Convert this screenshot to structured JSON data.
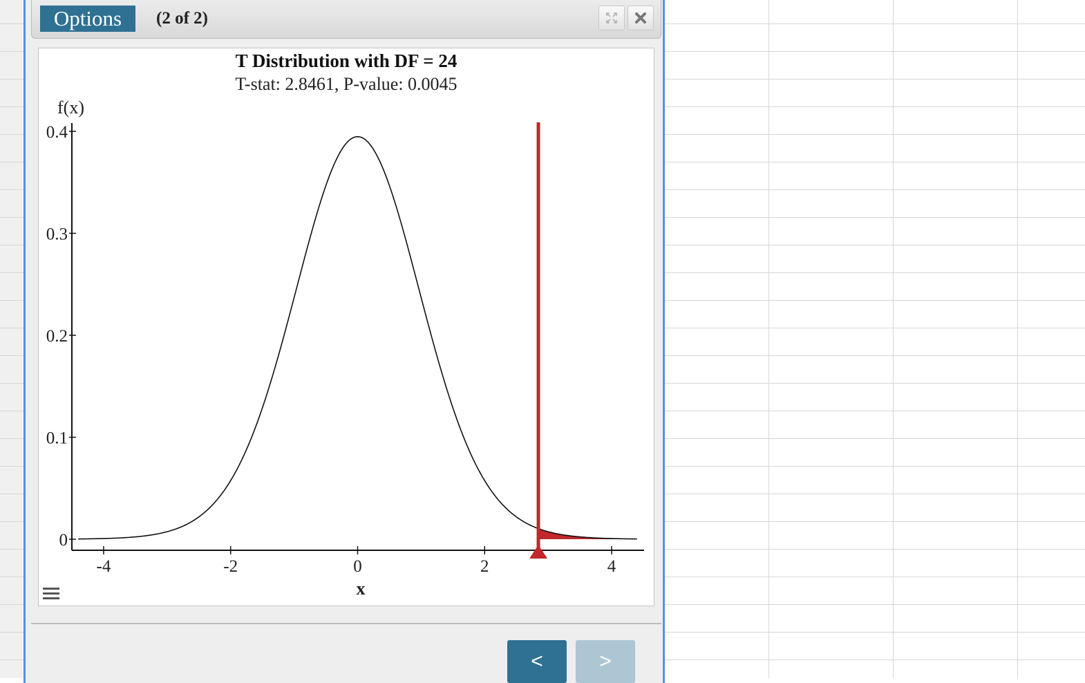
{
  "dialog": {
    "options_label": "Options",
    "page_count": "(2 of 2)",
    "prev_label": "<",
    "next_label": ">"
  },
  "colors": {
    "accent": "#2f7193",
    "accent_disabled": "#adc6d3",
    "border_accent": "#5b8ee6",
    "critical": "#c0282b"
  },
  "icons": [
    "expand-icon",
    "close-icon",
    "menu-icon"
  ],
  "chart_data": {
    "type": "line",
    "title": "T Distribution with DF = 24",
    "subtitle": "T-stat: 2.8461, P-value: 0.0045",
    "xlabel": "x",
    "ylabel": "f(x)",
    "df": 24,
    "t_stat": 2.8461,
    "p_value": 0.0045,
    "xlim": [
      -4.5,
      4.5
    ],
    "ylim": [
      0,
      0.4
    ],
    "curve_range": [
      -4.4,
      4.4
    ],
    "x_ticks": [
      -4,
      -2,
      0,
      2,
      4
    ],
    "x_tick_labels": [
      "-4",
      "-2",
      "0",
      "2",
      "4"
    ],
    "y_ticks": [
      0,
      0.1,
      0.2,
      0.3,
      0.4
    ],
    "y_tick_labels": [
      "0",
      "0.1",
      "0.2",
      "0.3",
      "0.4"
    ],
    "shaded_tail": "right",
    "grid": false,
    "legend": "none"
  }
}
